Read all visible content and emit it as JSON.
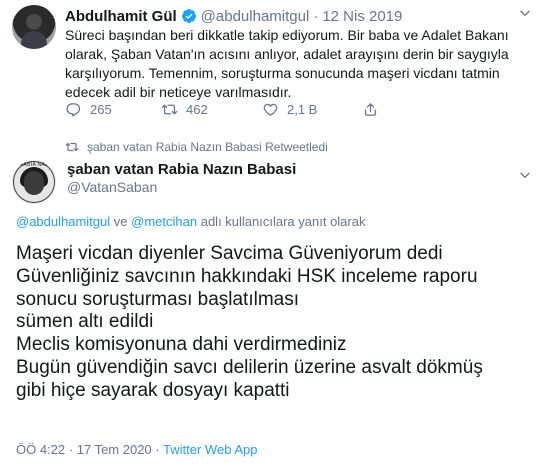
{
  "quoted_tweet": {
    "author_name": "Abdulhamit Gül",
    "author_handle": "@abdulhamitgul",
    "date": "12 Nis 2019",
    "text_lines": [
      "Süreci başından beri dikkatle takip ediyorum. Bir baba ve Adalet Bakanı",
      "olarak, Şaban Vatan'ın acısını anlıyor, adalet arayışını derin bir saygıyla",
      "karşılıyorum. Temennim, soruşturma sonucunda maşeri vicdanı tatmin",
      "edecek adil bir neticeye varılmasıdır."
    ],
    "reply_count": "265",
    "retweet_count": "462",
    "like_count": "2,1 B"
  },
  "retweet_label": "şaban vatan Rabia Nazın Babasi Retweetledi",
  "main_tweet": {
    "author_name": "şaban vatan Rabia Nazın Babasi",
    "author_handle": "@VatanSaban",
    "avatar_text": "RABİA NAZ",
    "reply_mention_1": "@abdulhamitgul",
    "reply_connector": "ve",
    "reply_mention_2": "@metcihan",
    "reply_suffix": "adlı kullanıcılara yanıt olarak",
    "text_lines": [
      "Maşeri vicdan diyenler Savcima Güveniyorum dedi",
      "Güvenliğiniz savcının hakkındaki HSK inceleme raporu",
      "sonucu soruşturması başlatılması",
      "sümen altı edildi",
      "Meclis komisyonuna dahi verdirmediniz",
      "Bugün güvendiğin savcı delilerin üzerine asvalt dökmüş",
      "gibi hiçe sayarak dosyayı kapatti"
    ],
    "time": "ÖÖ 4:22",
    "date": "17 Tem 2020",
    "separator": "·",
    "source_app": "Twitter Web App"
  },
  "colors": {
    "accent": "#1da1f2",
    "secondary_text": "#657786",
    "primary_text": "#14171a"
  },
  "icons": [
    "verified-badge-icon",
    "chevron-down-icon",
    "reply-icon",
    "retweet-icon",
    "like-icon",
    "share-icon"
  ]
}
